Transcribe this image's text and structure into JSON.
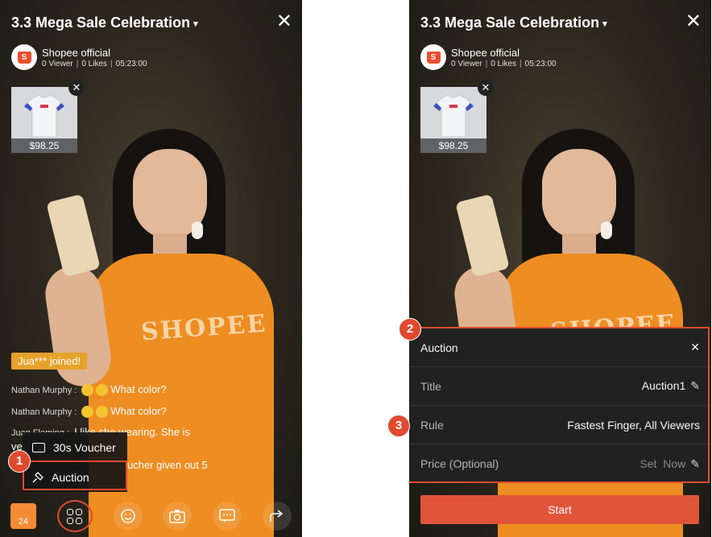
{
  "header": {
    "title": "3.3 Mega Sale Celebration",
    "caret": "▾",
    "close": "✕"
  },
  "shop": {
    "logo_letter": "S",
    "name": "Shopee official",
    "viewers": "0 Viewer",
    "likes": "0 Likes",
    "duration": "05:23:00",
    "separator": "|"
  },
  "product": {
    "price": "$98.25",
    "close": "✕"
  },
  "chat": {
    "joined": "Jua*** joined!",
    "messages": [
      {
        "name": "Nathan Murphy :",
        "text": "What color?"
      },
      {
        "name": "Nathan Murphy :",
        "text": "What color?"
      },
      {
        "name": "Juan Fleming :",
        "text": "I like she wearing. She is"
      },
      {
        "name": "ve",
        "text": ""
      },
      {
        "name": "",
        "text": "ucher given out 5"
      }
    ]
  },
  "menu": {
    "voucher": "30s Voucher",
    "auction": "Auction"
  },
  "bottom_bar": {
    "bag_count": "24"
  },
  "badges": {
    "one": "1",
    "two": "2",
    "three": "3"
  },
  "auction_panel": {
    "title": "Auction",
    "close": "✕",
    "rows": [
      {
        "label": "Title",
        "value": "Auction1"
      },
      {
        "label": "Rule",
        "value": "Fastest Finger, All Viewers"
      },
      {
        "label": "Price (Optional)",
        "value": "Set  Now"
      }
    ],
    "pencil": "✎",
    "start": "Start"
  },
  "colors": {
    "accent": "#e04a2f",
    "shopee_orange": "#ee4d2d",
    "joined_badge": "#e6a22b",
    "panel_bg": "#212121"
  }
}
